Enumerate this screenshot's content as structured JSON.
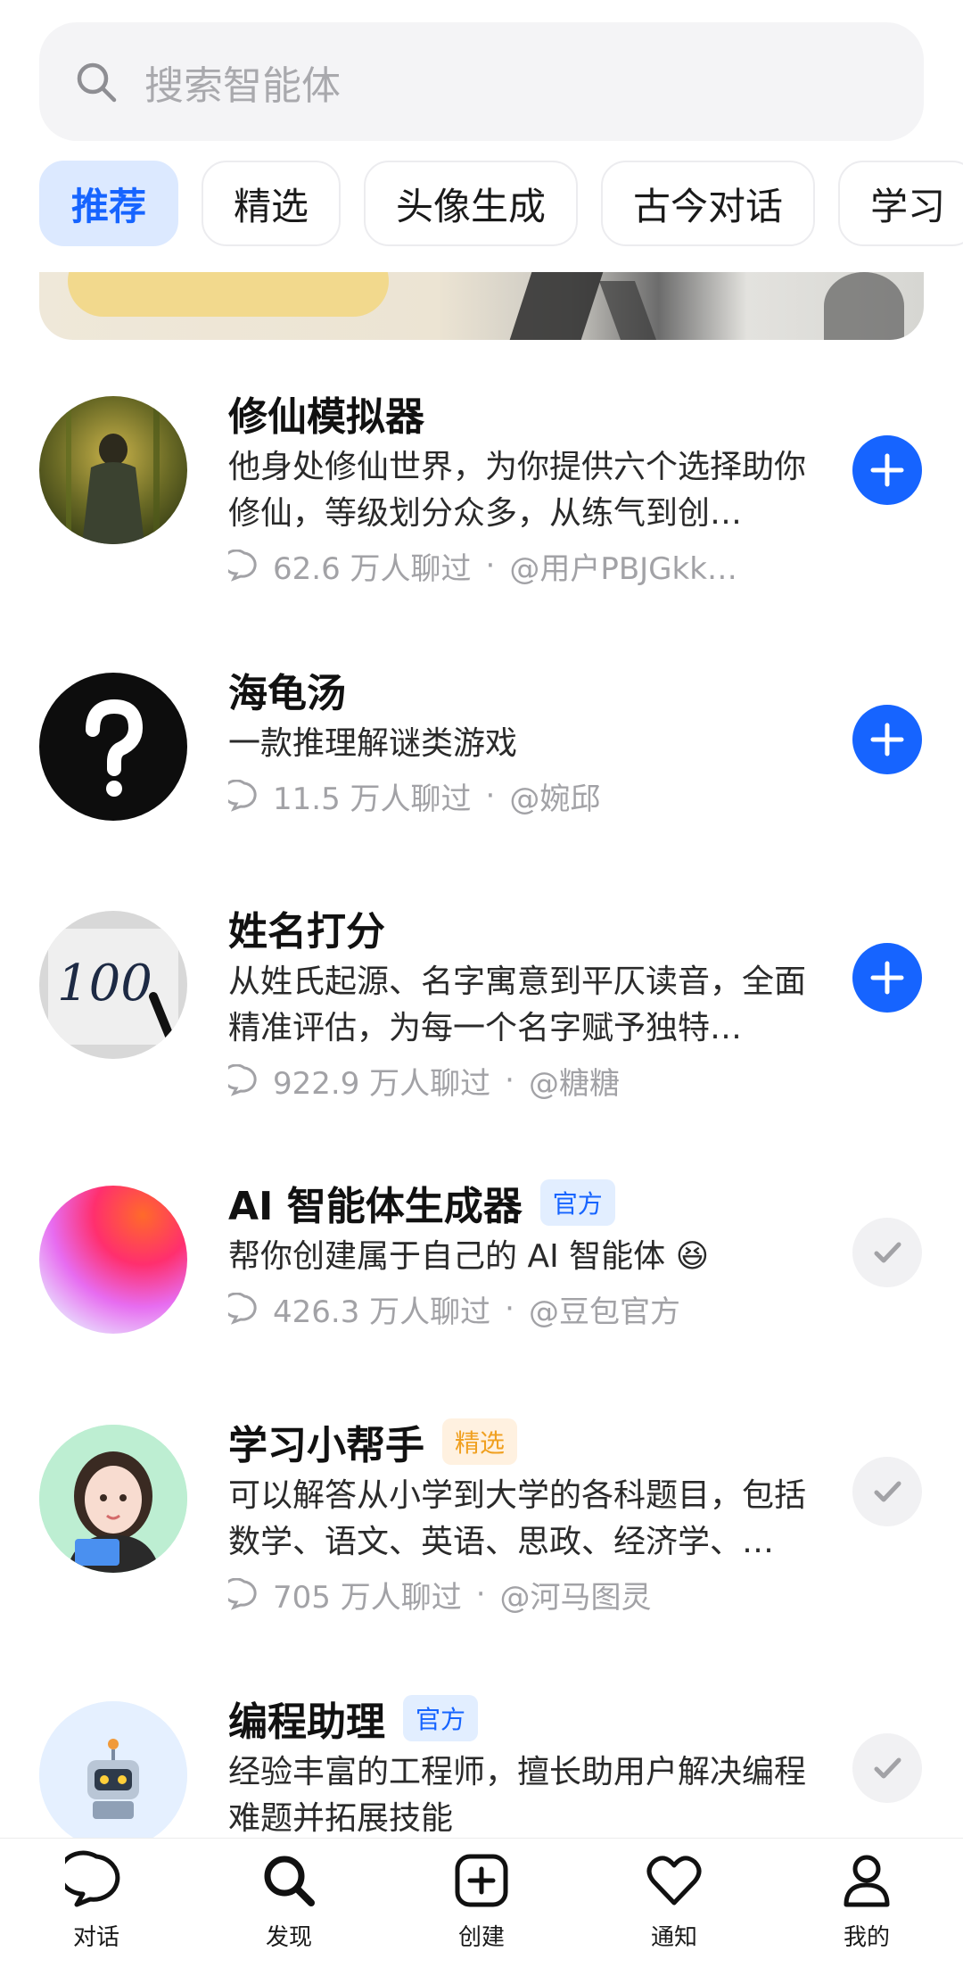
{
  "search": {
    "placeholder": "搜索智能体"
  },
  "tabs": [
    {
      "label": "推荐",
      "active": true
    },
    {
      "label": "精选"
    },
    {
      "label": "头像生成"
    },
    {
      "label": "古今对话"
    },
    {
      "label": "学习"
    }
  ],
  "agents": [
    {
      "title": "修仙模拟器",
      "badge": "",
      "desc": "他身处修仙世界，为你提供六个选择助你修仙，等级划分众多，从练气到创…",
      "count": "62.6 万人聊过",
      "author": "@用户PBJGkk…",
      "action": "add",
      "avatar": "bamboo-warrior"
    },
    {
      "title": "海龟汤",
      "badge": "",
      "desc": "一款推理解谜类游戏",
      "count": "11.5 万人聊过",
      "author": "@婉邱",
      "action": "add",
      "avatar": "question-mark"
    },
    {
      "title": "姓名打分",
      "badge": "",
      "desc": "从姓氏起源、名字寓意到平仄读音，全面精准评估，为每一个名字赋予独特…",
      "count": "922.9 万人聊过",
      "author": "@糖糖",
      "action": "add",
      "avatar": "score-100"
    },
    {
      "title": "AI 智能体生成器",
      "badge": "官方",
      "badge_type": "official",
      "desc": "帮你创建属于自己的 AI 智能体 😆",
      "count": "426.3 万人聊过",
      "author": "@豆包官方",
      "action": "added",
      "avatar": "gradient-orb"
    },
    {
      "title": "学习小帮手",
      "badge": "精选",
      "badge_type": "featured",
      "desc": "可以解答从小学到大学的各科题目，包括数学、语文、英语、思政、经济学、…",
      "count": "705 万人聊过",
      "author": "@河马图灵",
      "action": "added",
      "avatar": "study-girl"
    },
    {
      "title": "编程助理",
      "badge": "官方",
      "badge_type": "official",
      "desc": "经验丰富的工程师，擅长助用户解决编程难题并拓展技能",
      "count": "",
      "author": "",
      "action": "added",
      "avatar": "robot"
    }
  ],
  "nav": [
    {
      "label": "对话",
      "icon": "chat-icon"
    },
    {
      "label": "发现",
      "icon": "search-icon"
    },
    {
      "label": "创建",
      "icon": "plus-square-icon"
    },
    {
      "label": "通知",
      "icon": "heart-icon"
    },
    {
      "label": "我的",
      "icon": "profile-icon"
    }
  ],
  "colors": {
    "accent": "#1664ff",
    "accent_bg": "#dce9ff",
    "muted": "#a2a2a6"
  }
}
